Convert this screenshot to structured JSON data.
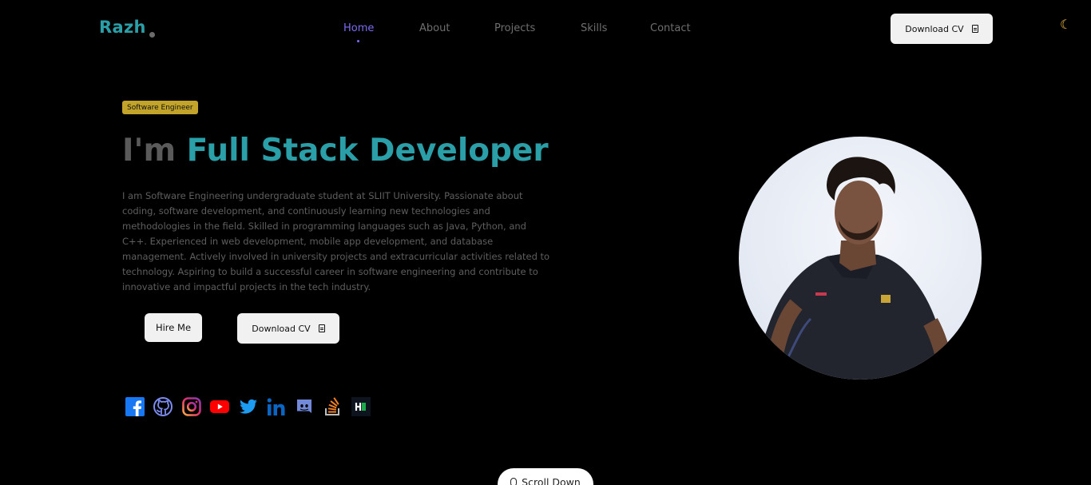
{
  "brand": {
    "logo": "Razh"
  },
  "nav": {
    "items": [
      {
        "label": "Home",
        "active": true
      },
      {
        "label": "About",
        "active": false
      },
      {
        "label": "Projects",
        "active": false
      },
      {
        "label": "Skills",
        "active": false
      },
      {
        "label": "Contact",
        "active": false
      }
    ],
    "cv_label": "Download CV",
    "theme_toggle_icon": "moon-icon"
  },
  "hero": {
    "badge": "Software Engineer",
    "headline_prefix": "I'm",
    "headline_role": "Full Stack Developer",
    "description": "I am Software Engineering undergraduate student at SLIIT University. Passionate about coding, software development, and continuously learning new technologies and methodologies in the field. Skilled in programming languages such as Java, Python, and C++. Experienced in web development, mobile app development, and database management. Actively involved in university projects and extracurricular activities related to technology. Aspiring to build a successful career in software engineering and contribute to innovative and impactful projects in the tech industry.",
    "hire_label": "Hire Me",
    "cv_label": "Download CV"
  },
  "social": [
    "facebook-icon",
    "github-icon",
    "instagram-icon",
    "youtube-icon",
    "twitter-icon",
    "linkedin-icon",
    "discord-icon",
    "stackoverflow-icon",
    "hackerrank-icon"
  ],
  "scroll": {
    "label": "Scroll Down"
  },
  "colors": {
    "accent": "#2a9fa8",
    "nav_active": "#7b6cf0",
    "badge": "#c2a42a",
    "background": "#000000"
  }
}
